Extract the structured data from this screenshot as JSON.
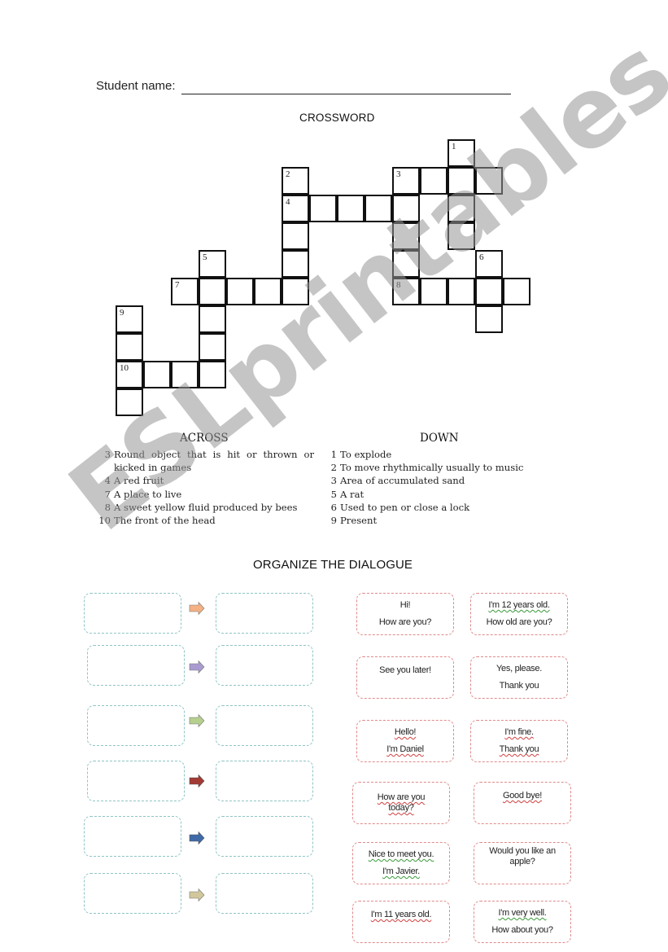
{
  "header": {
    "student_name_label": "Student name:"
  },
  "crossword": {
    "title": "CROSSWORD",
    "cells": [
      {
        "r": 0,
        "c": 12,
        "num": "1"
      },
      {
        "r": 1,
        "c": 6,
        "num": "2"
      },
      {
        "r": 1,
        "c": 10,
        "num": "3"
      },
      {
        "r": 1,
        "c": 11
      },
      {
        "r": 1,
        "c": 12
      },
      {
        "r": 1,
        "c": 13
      },
      {
        "r": 2,
        "c": 6,
        "num": "4"
      },
      {
        "r": 2,
        "c": 7
      },
      {
        "r": 2,
        "c": 8
      },
      {
        "r": 2,
        "c": 9
      },
      {
        "r": 2,
        "c": 10
      },
      {
        "r": 2,
        "c": 12
      },
      {
        "r": 3,
        "c": 6
      },
      {
        "r": 3,
        "c": 10
      },
      {
        "r": 3,
        "c": 12
      },
      {
        "r": 4,
        "c": 3,
        "num": "5"
      },
      {
        "r": 4,
        "c": 6
      },
      {
        "r": 4,
        "c": 10
      },
      {
        "r": 4,
        "c": 13,
        "num": "6"
      },
      {
        "r": 5,
        "c": 2,
        "num": "7"
      },
      {
        "r": 5,
        "c": 3
      },
      {
        "r": 5,
        "c": 4
      },
      {
        "r": 5,
        "c": 5
      },
      {
        "r": 5,
        "c": 6
      },
      {
        "r": 5,
        "c": 10,
        "num": "8"
      },
      {
        "r": 5,
        "c": 11
      },
      {
        "r": 5,
        "c": 12
      },
      {
        "r": 5,
        "c": 13
      },
      {
        "r": 5,
        "c": 14
      },
      {
        "r": 6,
        "c": 0,
        "num": "9"
      },
      {
        "r": 6,
        "c": 3
      },
      {
        "r": 6,
        "c": 13
      },
      {
        "r": 7,
        "c": 0
      },
      {
        "r": 7,
        "c": 3
      },
      {
        "r": 8,
        "c": 0,
        "num": "10"
      },
      {
        "r": 8,
        "c": 1
      },
      {
        "r": 8,
        "c": 2
      },
      {
        "r": 8,
        "c": 3
      },
      {
        "r": 9,
        "c": 0
      }
    ],
    "across_heading": "ACROSS",
    "down_heading": "DOWN",
    "across": [
      {
        "num": "3",
        "text": "Round object that is hit or thrown or",
        "cont": "kicked in games"
      },
      {
        "num": "4",
        "text": "A red fruit"
      },
      {
        "num": "7",
        "text": "A place to live"
      },
      {
        "num": "8",
        "text": "A sweet yellow fluid produced by bees"
      },
      {
        "num": "10",
        "text": "The front of the head"
      }
    ],
    "down": [
      {
        "num": "1",
        "text": "To explode"
      },
      {
        "num": "2",
        "text": "To move rhythmically usually to music"
      },
      {
        "num": "3",
        "text": "Area of accumulated sand"
      },
      {
        "num": "5",
        "text": "A rat"
      },
      {
        "num": "6",
        "text": "Used to pen or close a lock"
      },
      {
        "num": "9",
        "text": "Present"
      }
    ]
  },
  "dialogue": {
    "title": "ORGANIZE THE DIALOGUE",
    "arrow_colors": [
      "#f4b183",
      "#a99bd0",
      "#b5cf8e",
      "#a33a34",
      "#3f6aa8",
      "#d2c79a"
    ],
    "cards": [
      {
        "lines": [
          "Hi!",
          "How are you?"
        ]
      },
      {
        "lines": [
          "I'm 12 years old.",
          "How old are you?"
        ]
      },
      {
        "lines": [
          "See you later!"
        ]
      },
      {
        "lines": [
          "Yes, please.",
          "Thank you"
        ]
      },
      {
        "lines": [
          "Hello!",
          "I'm Daniel"
        ]
      },
      {
        "lines": [
          "I'm fine.",
          "Thank you"
        ]
      },
      {
        "lines": [
          "How are you",
          "today?"
        ]
      },
      {
        "lines": [
          "Good bye!"
        ]
      },
      {
        "lines": [
          "Nice to meet you.",
          "I'm Javier."
        ]
      },
      {
        "lines": [
          "Would you like an",
          "apple?"
        ]
      },
      {
        "lines": [
          "I'm 11 years old."
        ]
      },
      {
        "lines": [
          "I'm very well.",
          "How about you?"
        ]
      }
    ]
  },
  "watermark": {
    "text": "ESLprintables.com"
  }
}
